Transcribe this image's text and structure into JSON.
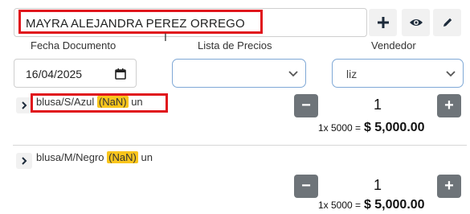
{
  "customer": {
    "name": "MAYRA ALEJANDRA PEREZ ORREGO"
  },
  "actions": {
    "add_icon": "plus-icon",
    "view_icon": "eye-icon",
    "edit_icon": "pencil-icon"
  },
  "labels": {
    "fecha_documento": "Fecha Documento",
    "lista_precios": "Lista de Precios",
    "vendedor": "Vendedor"
  },
  "fields": {
    "fecha_documento": "16/04/2025",
    "lista_precios": "",
    "vendedor": "liz"
  },
  "products": [
    {
      "name": "blusa/S/Azul",
      "tag": "(NaN)",
      "unit": "un",
      "quantity": "1",
      "calc": "1x 5000 =",
      "total": "$ 5,000.00"
    },
    {
      "name": "blusa/M/Negro",
      "tag": "(NaN)",
      "unit": "un",
      "quantity": "1",
      "calc": "1x 5000 =",
      "total": "$ 5,000.00"
    }
  ],
  "stepper": {
    "minus": "−",
    "plus": "+"
  },
  "colors": {
    "highlight": "#e0141c",
    "tag_bg": "#f9c51c",
    "stepper_bg": "#6e7479",
    "select_border": "#7fa8d6"
  }
}
